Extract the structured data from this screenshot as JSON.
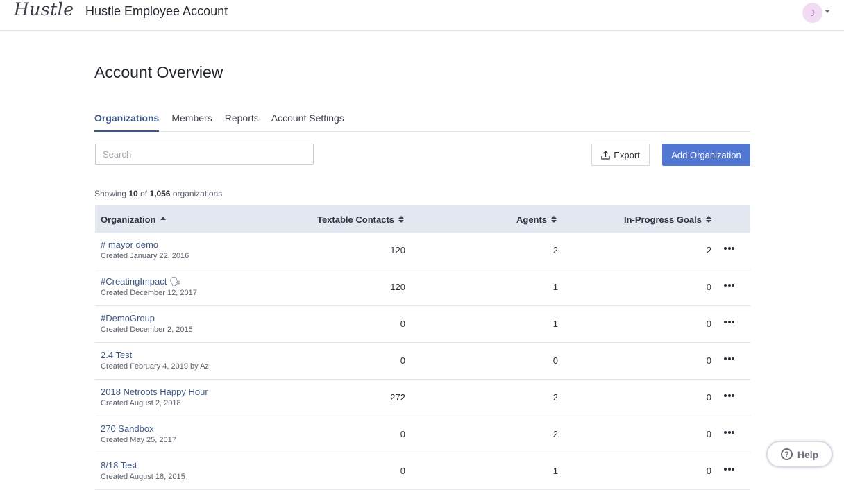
{
  "header": {
    "logo": "Hustle",
    "app_title": "Hustle Employee Account",
    "avatar_initial": "J"
  },
  "page": {
    "title": "Account Overview"
  },
  "tabs": [
    {
      "label": "Organizations",
      "active": true
    },
    {
      "label": "Members",
      "active": false
    },
    {
      "label": "Reports",
      "active": false
    },
    {
      "label": "Account Settings",
      "active": false
    }
  ],
  "toolbar": {
    "search_placeholder": "Search",
    "search_value": "",
    "export_label": "Export",
    "add_label": "Add Organization"
  },
  "summary": {
    "prefix": "Showing",
    "shown": "10",
    "of": "of",
    "total": "1,056",
    "suffix": "organizations"
  },
  "table": {
    "columns": {
      "organization": "Organization",
      "contacts": "Textable Contacts",
      "agents": "Agents",
      "goals": "In-Progress Goals"
    },
    "rows": [
      {
        "name": "# mayor demo",
        "created": "Created January 22, 2016",
        "contacts": "120",
        "agents": "2",
        "goals": "2"
      },
      {
        "name": "#CreatingImpact 🗣",
        "created": "Created December 12, 2017",
        "contacts": "120",
        "agents": "1",
        "goals": "0"
      },
      {
        "name": "#DemoGroup",
        "created": "Created December 2, 2015",
        "contacts": "0",
        "agents": "1",
        "goals": "0"
      },
      {
        "name": "2.4 Test",
        "created": "Created February 4, 2019 by Az",
        "contacts": "0",
        "agents": "0",
        "goals": "0"
      },
      {
        "name": "2018 Netroots Happy Hour",
        "created": "Created August 2, 2018",
        "contacts": "272",
        "agents": "2",
        "goals": "0"
      },
      {
        "name": "270 Sandbox",
        "created": "Created May 25, 2017",
        "contacts": "0",
        "agents": "2",
        "goals": "0"
      },
      {
        "name": "8/18 Test",
        "created": "Created August 18, 2015",
        "contacts": "0",
        "agents": "1",
        "goals": "0"
      }
    ]
  },
  "help": {
    "label": "Help"
  },
  "colors": {
    "primary": "#5277d3",
    "link": "#3e5784",
    "header_bg": "#e3e7f0"
  }
}
